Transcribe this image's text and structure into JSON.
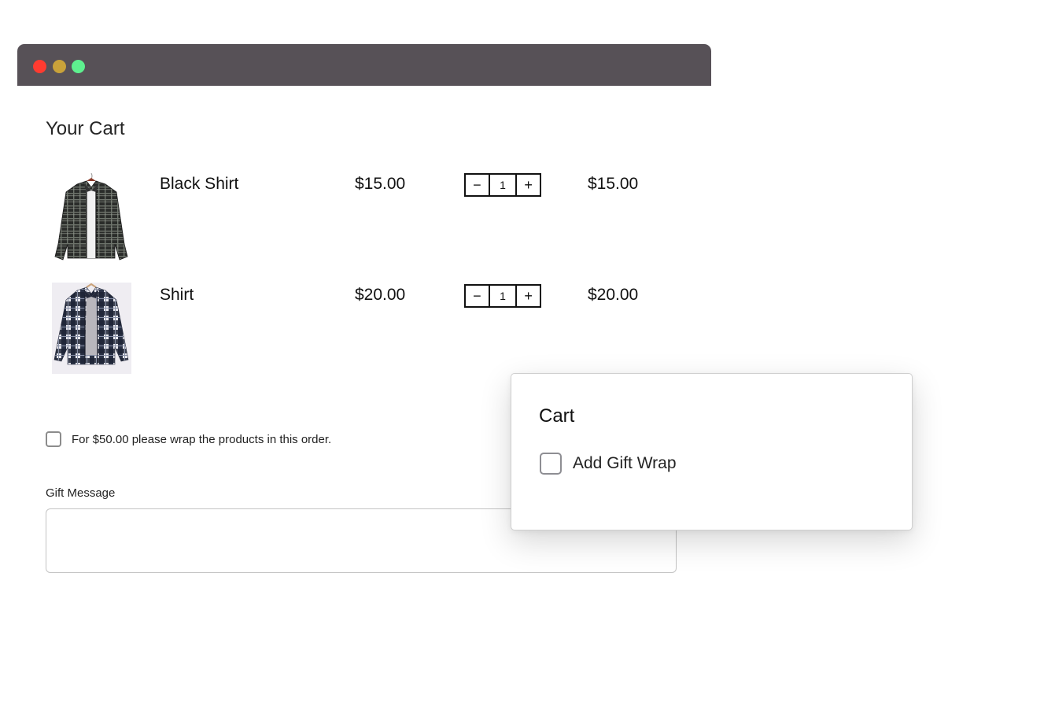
{
  "window": {
    "controls": [
      {
        "name": "close",
        "color": "#ff3b30"
      },
      {
        "name": "minimize",
        "color": "#c9a23a"
      },
      {
        "name": "zoom",
        "color": "#5ef08f"
      }
    ],
    "titlebar_color": "#575157"
  },
  "cart": {
    "title": "Your Cart",
    "items": [
      {
        "image_icon": "black-plaid-shirt-image",
        "name": "Black Shirt",
        "price": "$15.00",
        "quantity": "1",
        "subtotal": "$15.00",
        "decrement_symbol": "−",
        "increment_symbol": "+"
      },
      {
        "image_icon": "blue-plaid-shirt-image",
        "name": "Shirt",
        "price": "$20.00",
        "quantity": "1",
        "subtotal": "$20.00",
        "decrement_symbol": "−",
        "increment_symbol": "+"
      }
    ],
    "gift_wrap_option": {
      "label": "For $50.00 please wrap the products in this order.",
      "checked": false
    },
    "gift_message": {
      "label": "Gift Message",
      "value": ""
    }
  },
  "popup": {
    "title": "Cart",
    "option": {
      "label": "Add Gift Wrap",
      "checked": false
    }
  }
}
